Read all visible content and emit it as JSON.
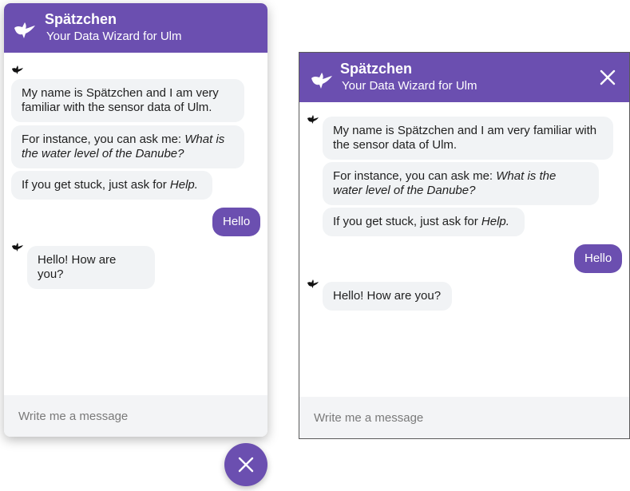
{
  "colors": {
    "brand": "#6b4fb0",
    "bubble_bot": "#f1f3f5",
    "composer_bg": "#f3f4f6"
  },
  "icons": {
    "logo": "bird-icon",
    "bot": "bird-icon",
    "close": "close-icon"
  },
  "left_chat": {
    "title": "Spätzchen",
    "subtitle": "Your Data Wizard for Ulm",
    "messages": {
      "m1": "My name is Spätzchen and I am very familiar with the sensor data of Ulm.",
      "m2_prefix": "For instance, you can ask me: ",
      "m2_emph": "What is the water level of the Danube?",
      "m3_prefix": "If you get stuck, just ask for ",
      "m3_emph": "Help.",
      "user": "Hello",
      "reply": "Hello! How are you?"
    },
    "composer_placeholder": "Write me a message"
  },
  "right_chat": {
    "title": "Spätzchen",
    "subtitle": "Your Data Wizard for Ulm",
    "messages": {
      "m1": "My name is Spätzchen and I am very familiar with the sensor data of Ulm.",
      "m2_prefix": "For instance, you can ask me: ",
      "m2_emph": "What is the water level of the Danube?",
      "m3_prefix": "If you get stuck, just ask for ",
      "m3_emph": "Help.",
      "user": "Hello",
      "reply": "Hello! How are you?"
    },
    "composer_placeholder": "Write me a message"
  }
}
